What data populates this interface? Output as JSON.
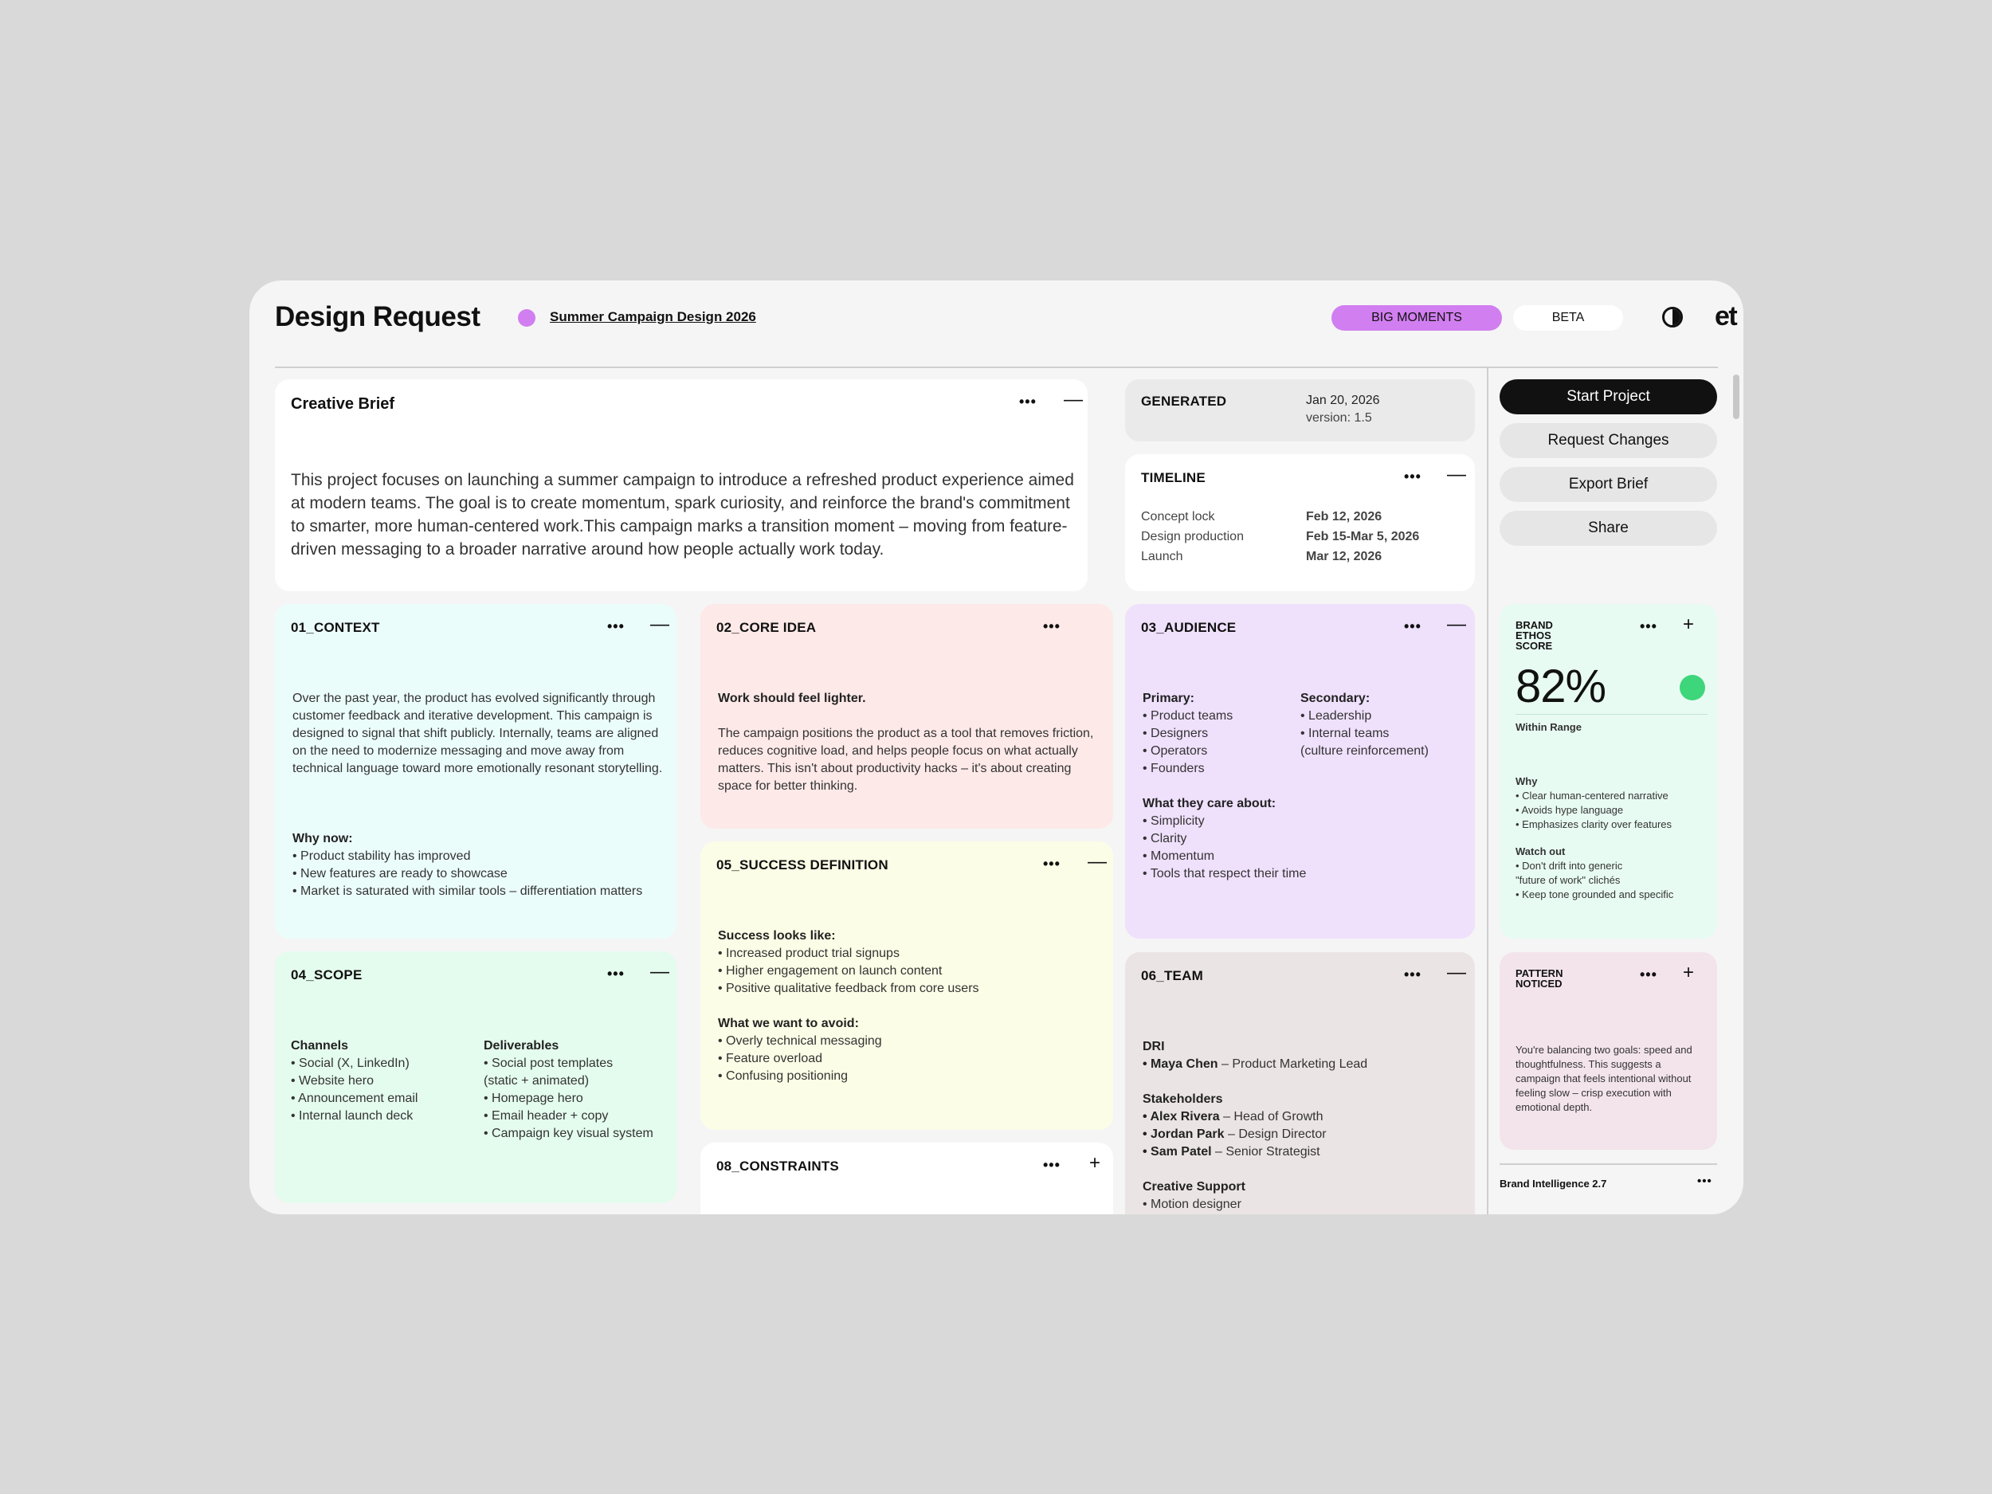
{
  "header": {
    "title": "Design Request",
    "project_link": "Summer Campaign Design 2026",
    "project_dot_color": "#d17ef0",
    "pill_big": "BIG MOMENTS",
    "pill_big_color": "#d17ef0",
    "pill_beta": "BETA",
    "logo": "et"
  },
  "brief": {
    "title": "Creative Brief",
    "text": "This project focuses on launching a summer campaign to introduce a refreshed product experience aimed at modern teams. The goal is to create momentum, spark curiosity, and reinforce the brand's commitment to smarter, more human-centered work.This campaign marks a transition moment – moving from feature-driven messaging to a broader narrative around how people actually work today."
  },
  "generated": {
    "label": "GENERATED",
    "date": "Jan 20, 2026",
    "version": "version: 1.5"
  },
  "timeline": {
    "title": "TIMELINE",
    "rows": [
      {
        "label": "Concept lock",
        "value": "Feb 12, 2026"
      },
      {
        "label": "Design production",
        "value": "Feb 15-Mar 5, 2026"
      },
      {
        "label": "Launch",
        "value": "Mar 12, 2026"
      }
    ]
  },
  "actions": {
    "start": "Start Project",
    "request": "Request Changes",
    "export": "Export Brief",
    "share": "Share"
  },
  "context": {
    "title": "01_CONTEXT",
    "color": "#ebfdfb",
    "p1": "Over the past year, the product has evolved significantly through customer feedback and iterative development. This campaign is designed to signal that shift publicly. Internally, teams are aligned on the need to modernize messaging and move away from technical language toward more emotionally resonant storytelling.",
    "why_label": "Why now:",
    "why_items": [
      "• Product stability has improved",
      "• New features are ready to showcase",
      "• Market is saturated with similar tools – differentiation matters"
    ]
  },
  "core": {
    "title": "02_CORE IDEA",
    "color": "#fde9e8",
    "headline": "Work should feel lighter.",
    "text": "The campaign positions the product as a tool that removes friction, reduces cognitive load, and helps people focus on what actually matters. This isn't about productivity hacks – it's about creating space for better thinking."
  },
  "audience": {
    "title": "03_AUDIENCE",
    "color": "#efe0fc",
    "primary_label": "Primary:",
    "primary_items": [
      "• Product teams",
      "• Designers",
      "• Operators",
      "• Founders"
    ],
    "secondary_label": "Secondary:",
    "secondary_items": [
      "• Leadership",
      "• Internal teams",
      "(culture reinforcement)"
    ],
    "care_label": "What they care about:",
    "care_items": [
      "• Simplicity",
      "• Clarity",
      "• Momentum",
      "• Tools that respect their time"
    ]
  },
  "scope": {
    "title": "04_SCOPE",
    "color": "#e4fcee",
    "channels_label": "Channels",
    "channels": [
      "• Social (X, LinkedIn)",
      "• Website hero",
      "• Announcement email",
      "• Internal launch deck"
    ],
    "deliverables_label": "Deliverables",
    "deliverables": [
      "• Social post templates",
      "(static + animated)",
      "• Homepage hero",
      "• Email header + copy",
      "• Campaign key visual system"
    ]
  },
  "success": {
    "title": "05_SUCCESS DEFINITION",
    "color": "#fcfde6",
    "looks_label": "Success looks like:",
    "looks_items": [
      "• Increased product trial signups",
      "• Higher engagement on launch content",
      "• Positive qualitative feedback from core users"
    ],
    "avoid_label": "What we want to avoid:",
    "avoid_items": [
      "• Overly technical messaging",
      "• Feature overload",
      "• Confusing positioning"
    ]
  },
  "team": {
    "title": "06_TEAM",
    "color": "#ebe4e4",
    "dri_label": "DRI",
    "dri": {
      "name": "• Maya Chen",
      "role": "Product Marketing Lead"
    },
    "stakeholders_label": "Stakeholders",
    "stakeholders": [
      {
        "name": "• Alex Rivera",
        "role": "Head of Growth"
      },
      {
        "name": "• Jordan Park",
        "role": "Design Director"
      },
      {
        "name": "• Sam Patel",
        "role": "Senior Strategist"
      }
    ],
    "support_label": "Creative Support",
    "support_items": [
      "• Motion designer"
    ]
  },
  "constraints": {
    "title": "08_CONSTRAINTS"
  },
  "ethos": {
    "title": "BRAND ETHOS SCORE",
    "score": "82%",
    "status": "Within Range",
    "status_color": "#3dd67a",
    "color": "#e8fbf3",
    "why_label": "Why",
    "why_items": [
      "• Clear human-centered narrative",
      "• Avoids hype language",
      "• Emphasizes clarity over features"
    ],
    "watch_label": "Watch out",
    "watch_items": [
      "• Don't drift into generic",
      "\"future of work\" clichés",
      "• Keep tone grounded and specific"
    ]
  },
  "pattern": {
    "title": "PATTERN NOTICED",
    "color": "#f3e4ec",
    "text": "You're balancing two goals: speed and thoughtfulness. This suggests a campaign that feels intentional without feeling slow – crisp execution with emotional depth."
  },
  "footer": {
    "label": "Brand Intelligence 2.7"
  }
}
